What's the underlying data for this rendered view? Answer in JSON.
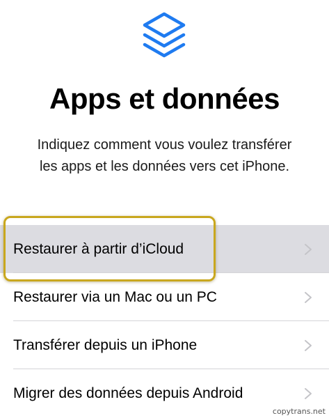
{
  "header": {
    "icon": "stack-layers-icon",
    "title": "Apps et données",
    "subtitle_lines": [
      "Indiquez comment vous voulez transférer",
      "les apps et les données vers cet iPhone."
    ]
  },
  "options": [
    {
      "label": "Restaurer à partir d’iCloud",
      "highlighted": true
    },
    {
      "label": "Restaurer via un Mac ou un PC",
      "highlighted": false
    },
    {
      "label": "Transférer depuis un iPhone",
      "highlighted": false
    },
    {
      "label": "Migrer des données depuis Android",
      "highlighted": false
    }
  ],
  "watermark": "copytrans.net",
  "colors": {
    "icon_blue": "#1f7bf0",
    "highlight_row": "#dcdce1",
    "annotation_frame": "#c9a71e",
    "chevron": "#c4c4c8"
  }
}
